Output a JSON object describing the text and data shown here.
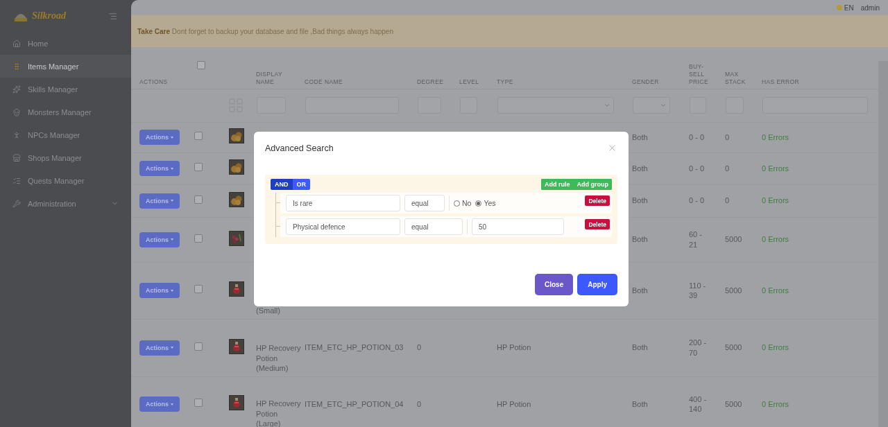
{
  "sidebar": {
    "brand": "Silkroad",
    "items": [
      {
        "label": "Home",
        "selected": false
      },
      {
        "label": "Items Manager",
        "selected": true
      },
      {
        "label": "Skills Manager",
        "selected": false
      },
      {
        "label": "Monsters Manager",
        "selected": false
      },
      {
        "label": "NPCs Manager",
        "selected": false
      },
      {
        "label": "Shops Manager",
        "selected": false
      },
      {
        "label": "Quests Manager",
        "selected": false
      },
      {
        "label": "Administration",
        "selected": false,
        "expanded": false
      }
    ]
  },
  "topbar": {
    "language": "EN",
    "user": "admin"
  },
  "alert": {
    "text": "**Take Care** Dont forget to backup your database and file ,Bad things always happen"
  },
  "table": {
    "header_checked": false,
    "columns": [
      "ACTIONS",
      "",
      "",
      "DISPLAY NAME",
      "CODE NAME",
      "DEGREE",
      "LEVEL",
      "TYPE",
      "GENDER",
      "BUY-SELL PRICE",
      "MAX STACK",
      "HAS ERROR"
    ],
    "rows": [
      {
        "action": "Actions",
        "checked": false,
        "gender": "Both",
        "price": "0 - 0",
        "max_stack": "0",
        "errors": "0 Errors"
      },
      {
        "action": "Actions",
        "checked": false,
        "gender": "Both",
        "price": "0 - 0",
        "max_stack": "0",
        "errors": "0 Errors"
      },
      {
        "action": "Actions",
        "checked": false,
        "gender": "Both",
        "price": "0 - 0",
        "max_stack": "0",
        "errors": "0 Errors"
      },
      {
        "action": "Actions",
        "checked": false,
        "gender": "Both",
        "price": "60 - 21",
        "max_stack": "5000",
        "errors": "0 Errors"
      },
      {
        "action": "Actions",
        "checked": false,
        "display_name": "(Small)",
        "gender": "Both",
        "price": "110 - 39",
        "max_stack": "5000",
        "errors": "0 Errors"
      },
      {
        "action": "Actions",
        "checked": false,
        "display_name": "HP Recovery Potion (Medium)",
        "code_name": "ITEM_ETC_HP_POTION_03",
        "degree": "0",
        "type": "HP Potion",
        "gender": "Both",
        "price": "200 - 70",
        "max_stack": "5000",
        "errors": "0 Errors"
      },
      {
        "action": "Actions",
        "checked": false,
        "display_name": "HP Recovery Potion (Large)",
        "code_name": "ITEM_ETC_HP_POTION_04",
        "degree": "0",
        "type": "HP Potion",
        "gender": "Both",
        "price": "400 - 140",
        "max_stack": "5000",
        "errors": "0 Errors"
      }
    ]
  },
  "modal": {
    "title": "Advanced Search",
    "conditions": [
      {
        "label": "AND",
        "selected": true
      },
      {
        "label": "OR",
        "selected": false
      }
    ],
    "add_buttons": [
      "Add rule",
      "Add group"
    ],
    "rules": [
      {
        "kind": "radio",
        "field": "Is rare",
        "operator": "equal",
        "options": [
          {
            "label": "No",
            "selected": false
          },
          {
            "label": "Yes",
            "selected": true
          }
        ],
        "delete": "Delete"
      },
      {
        "kind": "input",
        "field": "Physical defence",
        "operator": "equal",
        "value": "50",
        "delete": "Delete"
      }
    ],
    "buttons": [
      "Close",
      "Apply"
    ]
  }
}
